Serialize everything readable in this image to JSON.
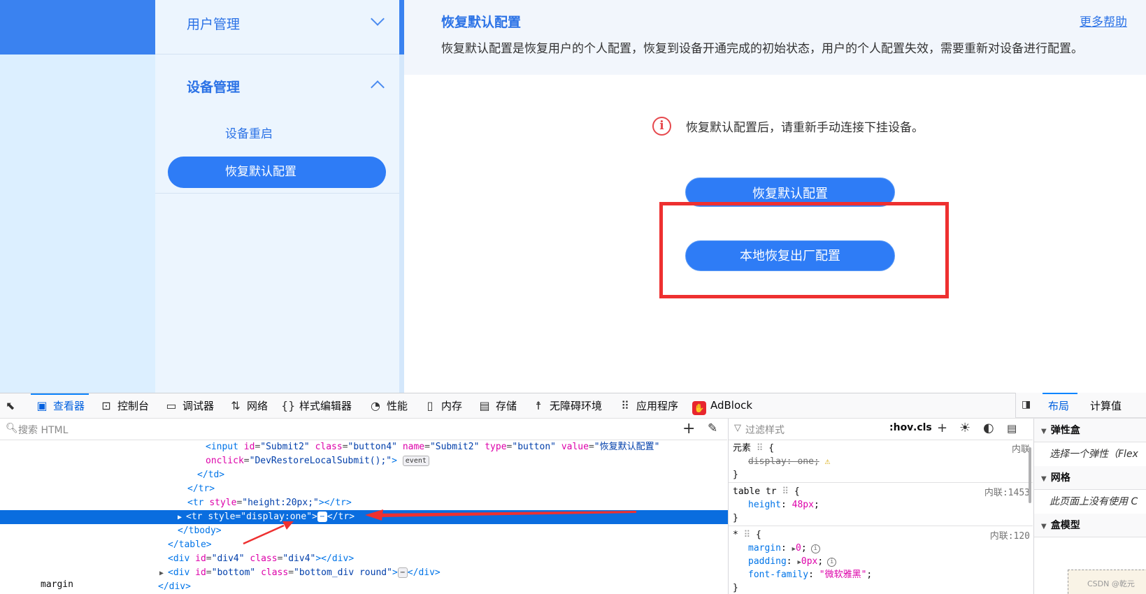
{
  "sidebar": {
    "group1": {
      "title": "用户管理"
    },
    "group2": {
      "title": "设备管理",
      "items": [
        {
          "label": "设备重启"
        },
        {
          "label": "恢复默认配置"
        }
      ]
    }
  },
  "main": {
    "title": "恢复默认配置",
    "help": "更多帮助",
    "description": "恢复默认配置是恢复用户的个人配置，恢复到设备开通完成的初始状态，用户的个人配置失效，需要重新对设备进行配置。",
    "warning": "恢复默认配置后，请重新手动连接下挂设备。",
    "buttons": {
      "restore_default": "恢复默认配置",
      "restore_factory": "本地恢复出厂配置"
    }
  },
  "devtools": {
    "tabs": {
      "inspector": "查看器",
      "console": "控制台",
      "debugger": "调试器",
      "network": "网络",
      "style_editor": "样式编辑器",
      "performance": "性能",
      "memory": "内存",
      "storage": "存储",
      "accessibility": "无障碍环境",
      "application": "应用程序",
      "adblock": "AdBlock"
    },
    "search_html_placeholder": "搜索 HTML",
    "html": {
      "l1_tag": "<input",
      "l1_attrs": [
        {
          "name": "id",
          "value": "\"Submit2\""
        },
        {
          "name": "class",
          "value": "\"button4\""
        },
        {
          "name": "name",
          "value": "\"Submit2\""
        },
        {
          "name": "type",
          "value": "\"button\""
        },
        {
          "name": "value",
          "value": "\"恢复默认配置\""
        }
      ],
      "l2_attr": "onclick",
      "l2_value": "\"DevRestoreLocalSubmit();\"",
      "l2_end": ">",
      "event_badge": "event",
      "l3": "</td>",
      "l4": "</tr>",
      "l5_open": "<tr",
      "l5_attr": "style",
      "l5_value": "\"height:20px;\"",
      "l5_close": "></tr>",
      "l6_open": "<tr",
      "l6_attr": "style",
      "l6_value": "\"display:one\"",
      "l6_gt": ">",
      "l6_close": "</tr>",
      "l6_more": "⋯",
      "l7": "</tbody>",
      "l8": "</table>",
      "l9_open": "<div",
      "l9_id": "\"div4\"",
      "l9_class": "\"div4\"",
      "l9_close": "></div>",
      "l10_open": "<div",
      "l10_id": "\"bottom\"",
      "l10_class": "\"bottom_div round\"",
      "l10_gt": ">",
      "l10_close": "</div>",
      "l11": "</div>",
      "attr_id": "id",
      "attr_class": "class"
    },
    "rules": {
      "filter_placeholder": "过滤样式",
      "hov": ":hov",
      "cls": ".cls",
      "r1_selector": "元素",
      "r1_source": "内联",
      "r1_prop": "display",
      "r1_value": "one",
      "r2_selector": "table tr",
      "r2_source": "内联:1453",
      "r2_prop": "height",
      "r2_value": "48px",
      "r3_selector": "*",
      "r3_source": "内联:120",
      "r3_p1": "margin",
      "r3_v1": "0",
      "r3_p2": "padding",
      "r3_v2": "0px",
      "r3_p3": "font-family",
      "r3_v3": "\"微软雅黑\"",
      "open_brace": "{",
      "close_brace": "}"
    },
    "layout": {
      "tab_layout": "布局",
      "tab_computed": "计算值",
      "flex_header": "弹性盒",
      "flex_note": "选择一个弹性（Flex",
      "grid_header": "网格",
      "grid_note": "此页面上没有使用 C",
      "box_header": "盒模型",
      "margin_label": "margin"
    },
    "watermark": "CSDN @乾元"
  },
  "colors": {
    "accent": "#2e7cf6",
    "sidebar_bg": "#ecf5fe",
    "highlight_box": "#ee3030",
    "selected_row": "#0a6ddf"
  }
}
